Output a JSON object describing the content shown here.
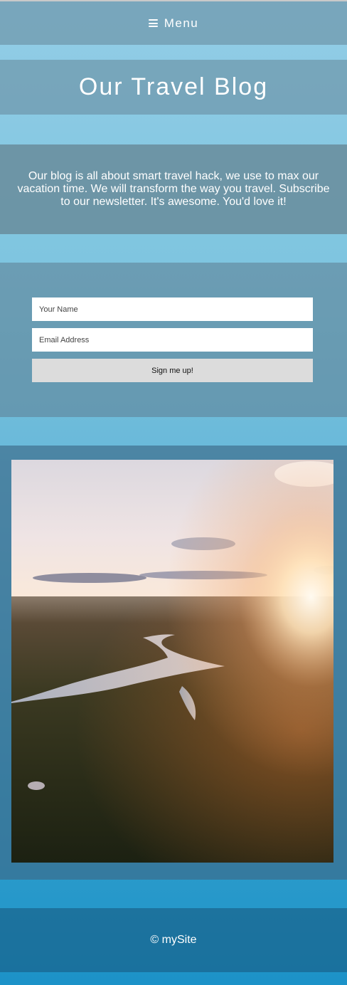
{
  "nav": {
    "menu_label": "Menu"
  },
  "header": {
    "title": "Our Travel Blog"
  },
  "intro": {
    "text": "Our blog is all about smart travel hack, we use to max our vacation time. We will transform the way you travel. Subscribe to our newsletter. It's awesome. You'd love it!"
  },
  "signup_form": {
    "name_placeholder": "Your Name",
    "email_placeholder": "Email Address",
    "submit_label": "Sign me up!"
  },
  "footer": {
    "copyright": "© mySite"
  },
  "icons": {
    "menu": "hamburger-icon"
  },
  "colors": {
    "page_gradient_top": "#93cde6",
    "page_gradient_bottom": "#1c92c8",
    "button_bg": "#dcdcdc",
    "text_light": "#ffffff"
  }
}
